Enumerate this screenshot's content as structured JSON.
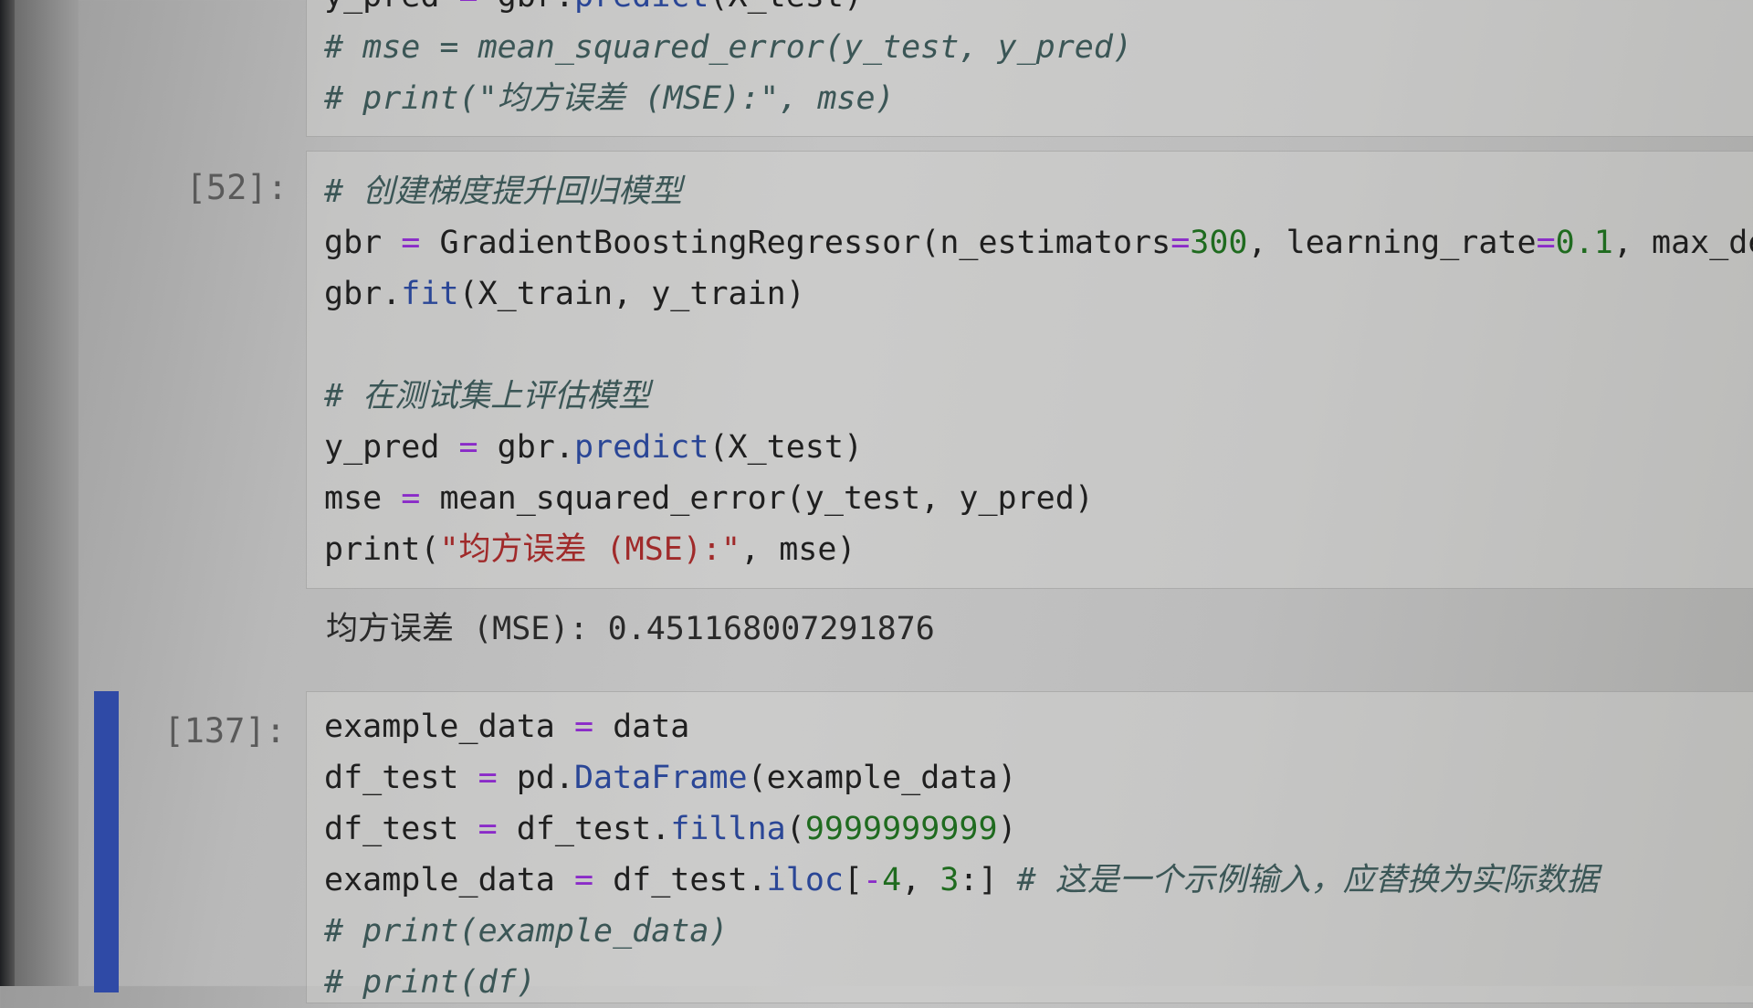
{
  "cells": [
    {
      "prompt": "",
      "lines": [
        [
          [
            "kw",
            "y_pred "
          ],
          [
            "op",
            "="
          ],
          [
            "kw",
            " gbr."
          ],
          [
            "fn",
            "predict"
          ],
          [
            "kw",
            "(X_test)"
          ]
        ],
        [
          [
            "cm",
            "# mse = mean_squared_error(y_test, y_pred)"
          ]
        ],
        [
          [
            "cm",
            "# print(\"均方误差 (MSE):\", mse)"
          ]
        ]
      ]
    },
    {
      "prompt": "[52]:",
      "lines": [
        [
          [
            "cm",
            "# 创建梯度提升回归模型"
          ]
        ],
        [
          [
            "kw",
            "gbr "
          ],
          [
            "op",
            "="
          ],
          [
            "kw",
            " GradientBoostingRegressor(n_estimators"
          ],
          [
            "op",
            "="
          ],
          [
            "num",
            "300"
          ],
          [
            "kw",
            ", learning_rate"
          ],
          [
            "op",
            "="
          ],
          [
            "num",
            "0.1"
          ],
          [
            "kw",
            ", max_de"
          ]
        ],
        [
          [
            "kw",
            "gbr."
          ],
          [
            "fn",
            "fit"
          ],
          [
            "kw",
            "(X_train, y_train)"
          ]
        ],
        [
          [
            "kw",
            ""
          ]
        ],
        [
          [
            "cm",
            "# 在测试集上评估模型"
          ]
        ],
        [
          [
            "kw",
            "y_pred "
          ],
          [
            "op",
            "="
          ],
          [
            "kw",
            " gbr."
          ],
          [
            "fn",
            "predict"
          ],
          [
            "kw",
            "(X_test)"
          ]
        ],
        [
          [
            "kw",
            "mse "
          ],
          [
            "op",
            "="
          ],
          [
            "kw",
            " mean_squared_error(y_test, y_pred)"
          ]
        ],
        [
          [
            "kw",
            "print("
          ],
          [
            "str",
            "\"均方误差 (MSE):\""
          ],
          [
            "kw",
            ", mse)"
          ]
        ]
      ],
      "output": "均方误差 (MSE): 0.451168007291876"
    },
    {
      "prompt": "[137]:",
      "lines": [
        [
          [
            "kw",
            "example_data "
          ],
          [
            "op",
            "="
          ],
          [
            "kw",
            " data"
          ]
        ],
        [
          [
            "kw",
            "df_test "
          ],
          [
            "op",
            "="
          ],
          [
            "kw",
            " pd."
          ],
          [
            "fn",
            "DataFrame"
          ],
          [
            "kw",
            "(example_data)"
          ]
        ],
        [
          [
            "kw",
            "df_test "
          ],
          [
            "op",
            "="
          ],
          [
            "kw",
            " df_test."
          ],
          [
            "fn",
            "fillna"
          ],
          [
            "kw",
            "("
          ],
          [
            "num",
            "9999999999"
          ],
          [
            "kw",
            ")"
          ]
        ],
        [
          [
            "kw",
            "example_data "
          ],
          [
            "op",
            "="
          ],
          [
            "kw",
            " df_test."
          ],
          [
            "fn",
            "iloc"
          ],
          [
            "kw",
            "["
          ],
          [
            "op",
            "-"
          ],
          [
            "num",
            "4"
          ],
          [
            "kw",
            ", "
          ],
          [
            "num",
            "3"
          ],
          [
            "kw",
            ":] "
          ],
          [
            "cm",
            "# 这是一个示例输入，应替换为实际数据"
          ]
        ],
        [
          [
            "cm",
            "# print(example_data)"
          ]
        ],
        [
          [
            "cm",
            "# print(df)"
          ]
        ]
      ]
    }
  ]
}
